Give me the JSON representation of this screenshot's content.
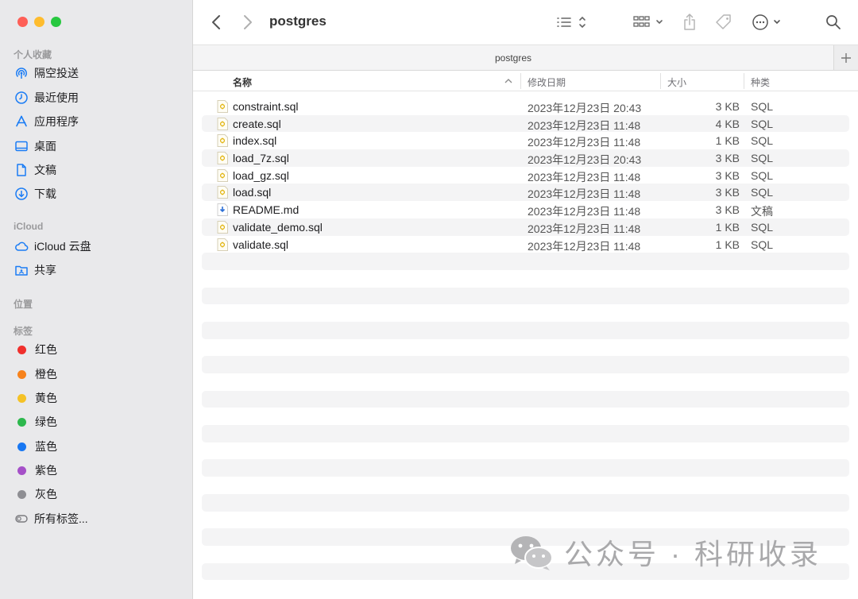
{
  "window": {
    "title": "postgres",
    "tab_title": "postgres"
  },
  "sidebar": {
    "favorites_header": "个人收藏",
    "favorites": [
      {
        "label": "隔空投送",
        "icon": "airdrop-icon"
      },
      {
        "label": "最近使用",
        "icon": "clock-icon"
      },
      {
        "label": "应用程序",
        "icon": "applications-icon"
      },
      {
        "label": "桌面",
        "icon": "desktop-icon"
      },
      {
        "label": "文稿",
        "icon": "document-icon"
      },
      {
        "label": "下载",
        "icon": "download-icon"
      }
    ],
    "icloud_header": "iCloud",
    "icloud": [
      {
        "label": "iCloud 云盘",
        "icon": "cloud-icon"
      },
      {
        "label": "共享",
        "icon": "shared-folder-icon"
      }
    ],
    "locations_header": "位置",
    "tags_header": "标签",
    "tags": [
      {
        "label": "红色",
        "color": "#f0302d"
      },
      {
        "label": "橙色",
        "color": "#f7821b"
      },
      {
        "label": "黄色",
        "color": "#f5c226"
      },
      {
        "label": "绿色",
        "color": "#2db84d"
      },
      {
        "label": "蓝色",
        "color": "#1877f2"
      },
      {
        "label": "紫色",
        "color": "#a550c8"
      },
      {
        "label": "灰色",
        "color": "#8e8e93"
      }
    ],
    "all_tags": "所有标签..."
  },
  "columns": {
    "name": "名称",
    "date": "修改日期",
    "size": "大小",
    "kind": "种类"
  },
  "files": [
    {
      "name": "constraint.sql",
      "date": "2023年12月23日 20:43",
      "size": "3 KB",
      "kind": "SQL",
      "icon": "sql-file-icon"
    },
    {
      "name": "create.sql",
      "date": "2023年12月23日 11:48",
      "size": "4 KB",
      "kind": "SQL",
      "icon": "sql-file-icon"
    },
    {
      "name": "index.sql",
      "date": "2023年12月23日 11:48",
      "size": "1 KB",
      "kind": "SQL",
      "icon": "sql-file-icon"
    },
    {
      "name": "load_7z.sql",
      "date": "2023年12月23日 20:43",
      "size": "3 KB",
      "kind": "SQL",
      "icon": "sql-file-icon"
    },
    {
      "name": "load_gz.sql",
      "date": "2023年12月23日 11:48",
      "size": "3 KB",
      "kind": "SQL",
      "icon": "sql-file-icon"
    },
    {
      "name": "load.sql",
      "date": "2023年12月23日 11:48",
      "size": "3 KB",
      "kind": "SQL",
      "icon": "sql-file-icon"
    },
    {
      "name": "README.md",
      "date": "2023年12月23日 11:48",
      "size": "3 KB",
      "kind": "文稿",
      "icon": "markdown-file-icon"
    },
    {
      "name": "validate_demo.sql",
      "date": "2023年12月23日 11:48",
      "size": "1 KB",
      "kind": "SQL",
      "icon": "sql-file-icon"
    },
    {
      "name": "validate.sql",
      "date": "2023年12月23日 11:48",
      "size": "1 KB",
      "kind": "SQL",
      "icon": "sql-file-icon"
    }
  ],
  "watermark": {
    "text": "公众号 · 科研收录",
    "icon": "wechat-icon"
  },
  "colors": {
    "accent": "#1a7cf5",
    "sidebar_bg": "#e9e9eb"
  }
}
